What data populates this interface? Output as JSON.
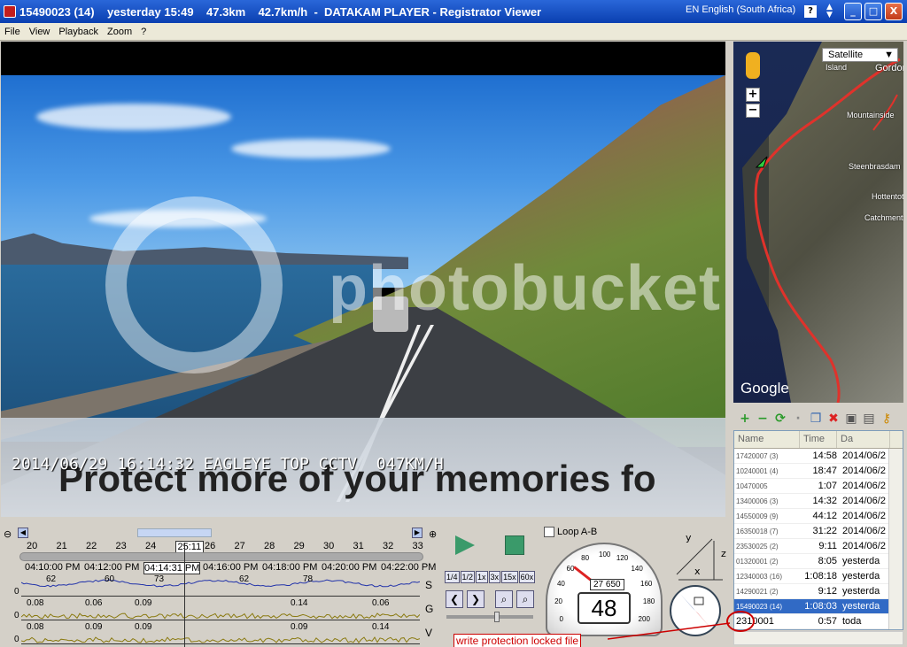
{
  "window": {
    "title": "15490023 (14)    yesterday 15:49    47.3km    42.7km/h  -  DATAKAM PLAYER - Registrator Viewer",
    "language": "EN English (South Africa)",
    "help": "?",
    "minimize": "_",
    "maximize": "□",
    "close": "X"
  },
  "menu": [
    "File",
    "View",
    "Playback",
    "Zoom",
    "?"
  ],
  "video": {
    "osd": "2014/06/29 16:14:32 EAGLEYE TOP CCTV  047KM/H",
    "banner": "Protect more of your memories fo",
    "watermark": "photobucket"
  },
  "map": {
    "type_label": "Satellite",
    "zoom_in": "+",
    "zoom_out": "−",
    "labels": [
      "Island",
      "Gordon's Bay",
      "Mountainside",
      "Steenbrasdam",
      "Hottentots",
      "Catchment"
    ],
    "attribution": "Google"
  },
  "file_list": {
    "headers": [
      "Name",
      "Time",
      "Da"
    ],
    "rows": [
      {
        "name": "17420007 (3)",
        "time": "14:58",
        "date": "2014/06/2"
      },
      {
        "name": "10240001 (4)",
        "time": "18:47",
        "date": "2014/06/2"
      },
      {
        "name": "10470005",
        "time": "1:07",
        "date": "2014/06/2"
      },
      {
        "name": "13400006 (3)",
        "time": "14:32",
        "date": "2014/06/2"
      },
      {
        "name": "14550009 (9)",
        "time": "44:12",
        "date": "2014/06/2"
      },
      {
        "name": "16350018 (7)",
        "time": "31:22",
        "date": "2014/06/2"
      },
      {
        "name": "23530025 (2)",
        "time": "9:11",
        "date": "2014/06/2"
      },
      {
        "name": "01320001 (2)",
        "time": "8:05",
        "date": "yesterda"
      },
      {
        "name": "12340003 (16)",
        "time": "1:08:18",
        "date": "yesterda"
      },
      {
        "name": "14290021 (2)",
        "time": "9:12",
        "date": "yesterda"
      },
      {
        "name": "15490023 (14)",
        "time": "1:08:03",
        "date": "yesterda"
      },
      {
        "name": "2310001",
        "time": "0:57",
        "date": "toda"
      }
    ],
    "selected_index": 10
  },
  "timeline": {
    "scale": [
      "20",
      "21",
      "22",
      "23",
      "24",
      "25:11",
      "26",
      "27",
      "28",
      "29",
      "30",
      "31",
      "32",
      "33"
    ],
    "times": [
      "04:10:00 PM",
      "04:12:00 PM",
      "04:14:31 PM",
      "04:16:00 PM",
      "04:18:00 PM",
      "04:20:00 PM",
      "04:22:00 PM"
    ],
    "graphs": [
      {
        "label": "S",
        "values": [
          "62",
          "60",
          "73",
          "62",
          "78"
        ]
      },
      {
        "label": "G",
        "values": [
          "0.08",
          "0.06",
          "0.09",
          "0.14",
          "0.06"
        ]
      },
      {
        "label": "V",
        "values": [
          "0.08",
          "0.09",
          "0.09",
          "0.09",
          "0.14"
        ]
      }
    ],
    "zero": "0"
  },
  "controls": {
    "loop_label": "Loop A-B",
    "speeds": [
      "1/4",
      "1/2",
      "1x",
      "3x",
      "15x",
      "60x"
    ],
    "gauge_ticks": [
      "0",
      "20",
      "40",
      "60",
      "80",
      "100",
      "120",
      "140",
      "160",
      "180",
      "200"
    ],
    "odometer": "27 650",
    "speed": "48",
    "axes": [
      "y",
      "z",
      "x"
    ],
    "write_protection": "write protection locked file"
  }
}
